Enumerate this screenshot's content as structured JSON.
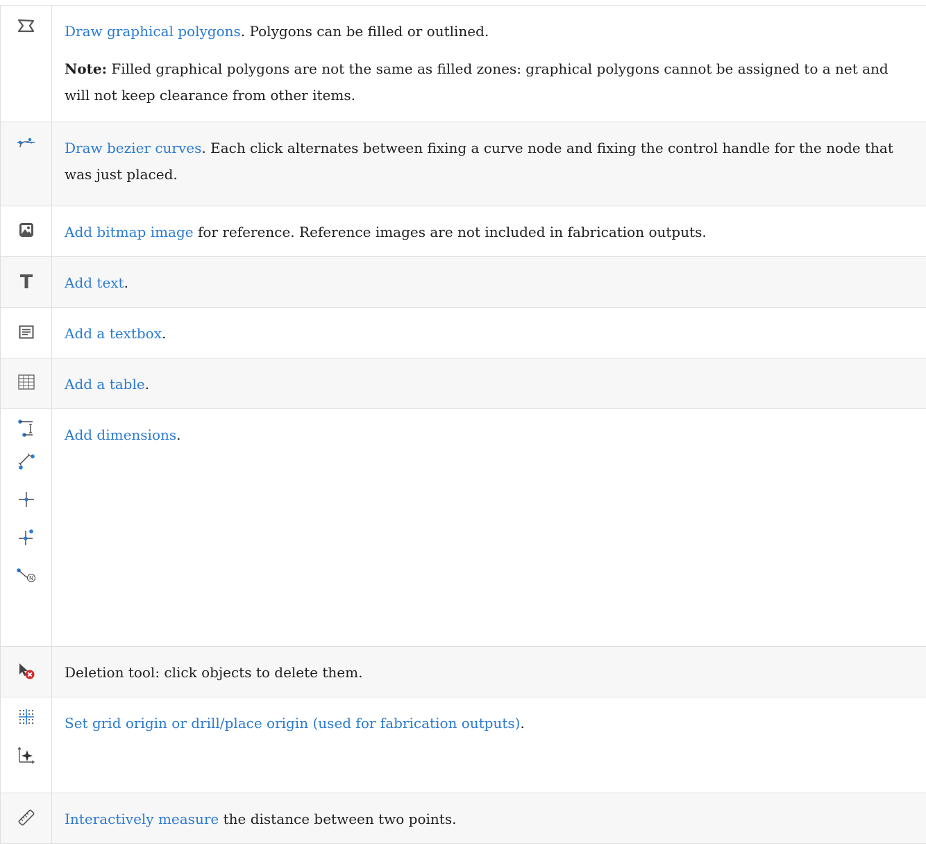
{
  "rows": [
    {
      "icon": "polygon-icon",
      "link": "Draw graphical polygons",
      "after": ". Polygons can be filled or outlined.",
      "note_label": "Note:",
      "note_text": " Filled graphical polygons are not the same as filled zones: graphical polygons cannot be assigned to a net and will not keep clearance from other items."
    },
    {
      "icon": "bezier-icon",
      "link": "Draw bezier curves",
      "after": ". Each click alternates between fixing a curve node and fixing the control handle for the node that was just placed."
    },
    {
      "icon": "image-icon",
      "link": "Add bitmap image",
      "after": " for reference. Reference images are not included in fabrication outputs."
    },
    {
      "icon": "text-icon",
      "link": "Add text",
      "after": "."
    },
    {
      "icon": "textbox-icon",
      "link": "Add a textbox",
      "after": "."
    },
    {
      "icon": "table-icon",
      "link": "Add a table",
      "after": "."
    },
    {
      "icons": [
        "dimension-orthogonal-icon",
        "dimension-aligned-icon",
        "dimension-center-icon",
        "dimension-radial-icon",
        "dimension-leader-icon"
      ],
      "link": "Add dimensions",
      "after": "."
    },
    {
      "icon": "delete-tool-icon",
      "text": "Deletion tool: click objects to delete them."
    },
    {
      "icons": [
        "grid-origin-icon",
        "drill-origin-icon"
      ],
      "link": "Set grid origin or drill/place origin (used for fabrication outputs)",
      "after": "."
    },
    {
      "icon": "measure-icon",
      "link": "Interactively measure",
      "after": " the distance between two points."
    }
  ]
}
